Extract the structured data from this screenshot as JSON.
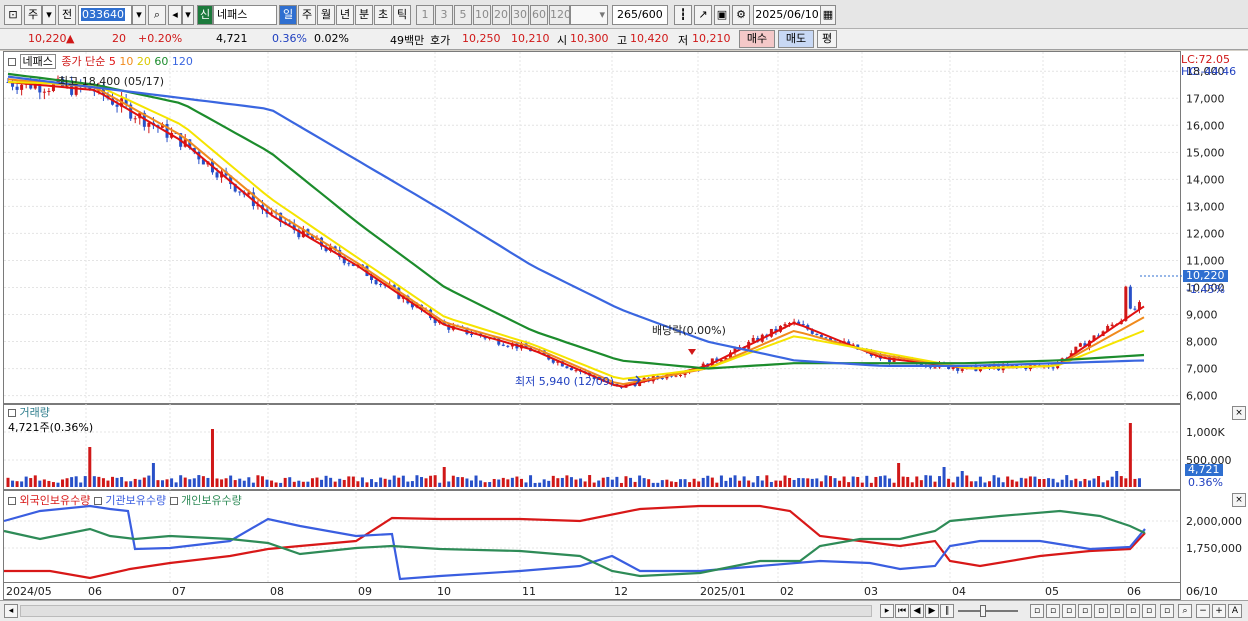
{
  "toolbar": {
    "market_label": "주",
    "prev_label": "전",
    "code": "033640",
    "new_badge": "신",
    "stock_name": "네패스",
    "periods": [
      "일",
      "주",
      "월",
      "년",
      "분",
      "초",
      "틱"
    ],
    "period_selected": "일",
    "intervals": [
      "1",
      "3",
      "5",
      "10",
      "20",
      "30",
      "60",
      "120"
    ],
    "count": "265",
    "total": "/600",
    "date": "2025/06/10"
  },
  "quote": {
    "price": "10,220",
    "arrow": "▲",
    "change": "20",
    "change_pct": "+0.20%",
    "volume": "4,721",
    "turnover_pct": "0.36%",
    "other_pct": "0.02%",
    "amount": "49백만",
    "ask_label": "호가",
    "ask": "10,250",
    "bid": "10,210",
    "open_label": "시",
    "open": "10,300",
    "high_label": "고",
    "high": "10,420",
    "low_label": "저",
    "low": "10,210",
    "buy_label": "매수",
    "sell_label": "매도",
    "eval_label": "평"
  },
  "price_panel": {
    "name": "네패스",
    "ma_label": "종가 단순",
    "ma_periods": [
      "5",
      "10",
      "20",
      "60",
      "120"
    ],
    "high_note": "최고 18,400 (05/17)",
    "low_note": "최저 5,940 (12/09)",
    "dividend_note": "배당락(0.00%)",
    "lc": "LC:72.05",
    "hc": "HC:-44.46",
    "current_price": "10,220",
    "current_pct": "-1.45%",
    "y_ticks": [
      "18,000",
      "17,000",
      "16,000",
      "15,000",
      "14,000",
      "13,000",
      "12,000",
      "11,000",
      "10,000",
      "9,000",
      "8,000",
      "7,000",
      "6,000"
    ]
  },
  "volume_panel": {
    "title": "거래량",
    "value_note": "4,721주(0.36%)",
    "y_ticks": [
      "1,000K",
      "500,000"
    ],
    "current": "4,721",
    "current_pct": "0.36%"
  },
  "holdings_panel": {
    "legend": [
      "외국인보유수량",
      "기관보유수량",
      "개인보유수량"
    ],
    "y_ticks": [
      "2,000,000",
      "1,750,000"
    ]
  },
  "x_axis": [
    "2024/05",
    "06",
    "07",
    "08",
    "09",
    "10",
    "11",
    "12",
    "2025/01",
    "02",
    "03",
    "04",
    "05",
    "06",
    "06/10"
  ],
  "colors": {
    "ma5": "#e01010",
    "ma10": "#f08a1c",
    "ma20": "#f5e400",
    "ma60": "#1c8c2c",
    "ma120": "#3a66e0",
    "up": "#d01818",
    "down": "#2850c8",
    "foreign": "#d81818",
    "institution": "#3a5ee0",
    "individual": "#2e8b57"
  },
  "chart_data": {
    "type": "line",
    "x": [
      "2024/05",
      "06",
      "07",
      "08",
      "09",
      "10",
      "11",
      "12",
      "2025/01",
      "02",
      "03",
      "04",
      "05",
      "06"
    ],
    "series": [
      {
        "name": "5",
        "values": [
          17600,
          17300,
          15400,
          12700,
          10800,
          8600,
          7700,
          6300,
          7100,
          8700,
          7400,
          7000,
          7100,
          9300
        ]
      },
      {
        "name": "10",
        "values": [
          17700,
          17400,
          15600,
          12900,
          10900,
          8700,
          7800,
          6400,
          7000,
          8400,
          7500,
          7000,
          7100,
          8900
        ]
      },
      {
        "name": "20",
        "values": [
          17600,
          17500,
          16000,
          13300,
          11100,
          8900,
          7900,
          6600,
          7000,
          8200,
          7600,
          7000,
          7100,
          8400
        ]
      },
      {
        "name": "60",
        "values": [
          17900,
          17500,
          16800,
          15000,
          12400,
          10000,
          8400,
          7300,
          7000,
          7200,
          7200,
          7200,
          7300,
          7500
        ]
      },
      {
        "name": "120",
        "values": [
          17800,
          17400,
          17000,
          16600,
          14700,
          12800,
          10800,
          9200,
          8000,
          7300,
          7100,
          7100,
          7200,
          7300
        ]
      }
    ],
    "ylim": [
      5800,
      18600
    ]
  }
}
